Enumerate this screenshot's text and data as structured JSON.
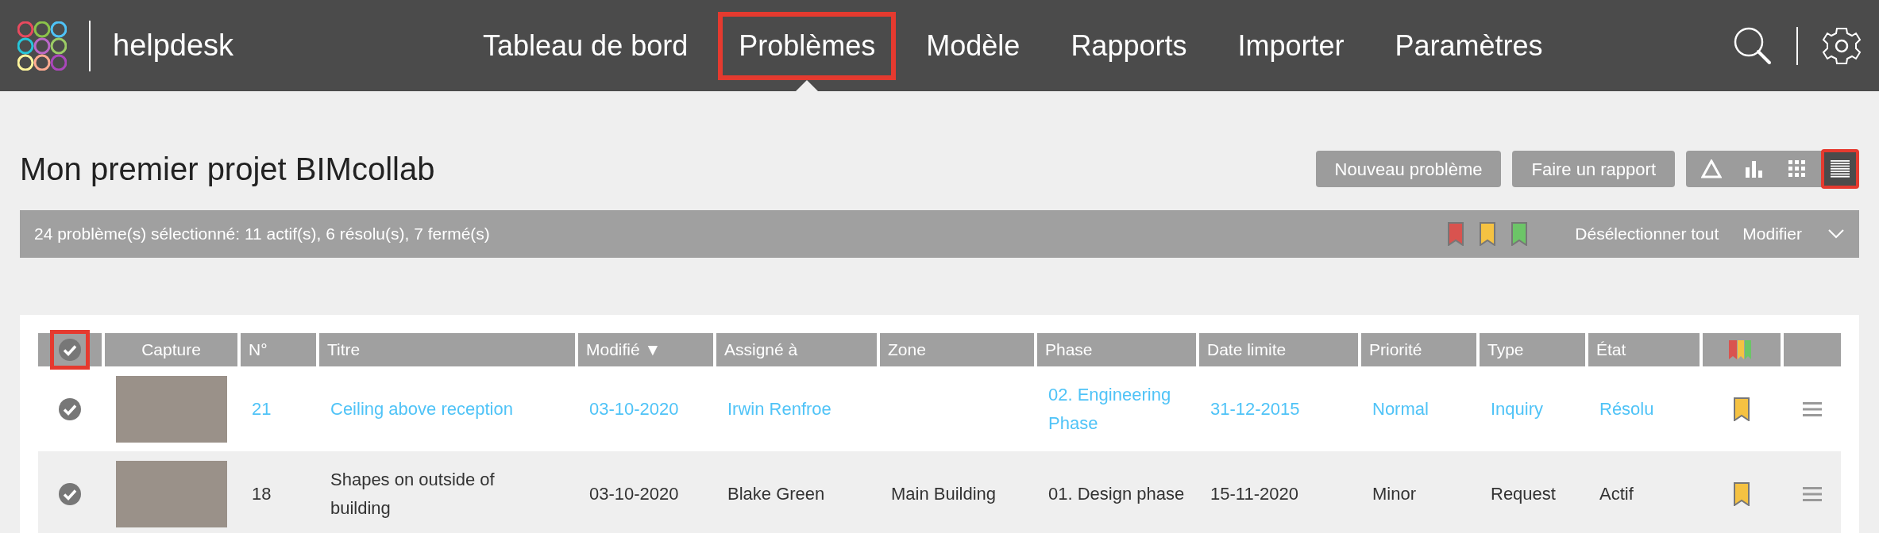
{
  "header": {
    "brand": "helpdesk",
    "nav": [
      {
        "label": "Tableau de bord",
        "selected": false,
        "highlighted": false
      },
      {
        "label": "Problèmes",
        "selected": true,
        "highlighted": true
      },
      {
        "label": "Modèle",
        "selected": false,
        "highlighted": false
      },
      {
        "label": "Rapports",
        "selected": false,
        "highlighted": false
      },
      {
        "label": "Importer",
        "selected": false,
        "highlighted": false
      },
      {
        "label": "Paramètres",
        "selected": false,
        "highlighted": false
      }
    ]
  },
  "project_title": "Mon premier projet BIMcollab",
  "actions": [
    "Nouveau problème",
    "Faire un rapport"
  ],
  "views": [
    {
      "kind": "triangle",
      "selected": false,
      "highlighted": false
    },
    {
      "kind": "bars",
      "selected": false,
      "highlighted": false
    },
    {
      "kind": "grid",
      "selected": false,
      "highlighted": false
    },
    {
      "kind": "list",
      "selected": true,
      "highlighted": true
    }
  ],
  "selection_bar": {
    "summary": "24 problème(s) sélectionné: 11 actif(s), 6 résolu(s), 7 fermé(s)",
    "flags": [
      {
        "color": "#d9534f"
      },
      {
        "color": "#f5c242"
      },
      {
        "color": "#6cc567"
      }
    ],
    "deselect": "Désélectionner tout",
    "modify": "Modifier"
  },
  "table": {
    "header_checkbox": {
      "checked": true,
      "highlighted": true
    },
    "capture_header": "Capture",
    "columns": [
      "N°",
      "Titre",
      "Modifié ▼",
      "Assigné à",
      "Zone",
      "Phase",
      "Date limite",
      "Priorité",
      "Type",
      "État"
    ],
    "rows": [
      {
        "checked": true,
        "hovered": true,
        "cells": [
          "21",
          "Ceiling above reception",
          "03-10-2020",
          "Irwin Renfroe",
          "",
          "02. Engineering Phase",
          "31-12-2015",
          "Normal",
          "Inquiry",
          "Résolu"
        ],
        "color": "#f5c242"
      },
      {
        "checked": true,
        "hovered": false,
        "cells": [
          "18",
          "Shapes on outside of building",
          "03-10-2020",
          "Blake Green",
          "Main Building",
          "01. Design phase",
          "15-11-2020",
          "Minor",
          "Request",
          "Actif"
        ],
        "color": "#f5c242"
      }
    ]
  }
}
